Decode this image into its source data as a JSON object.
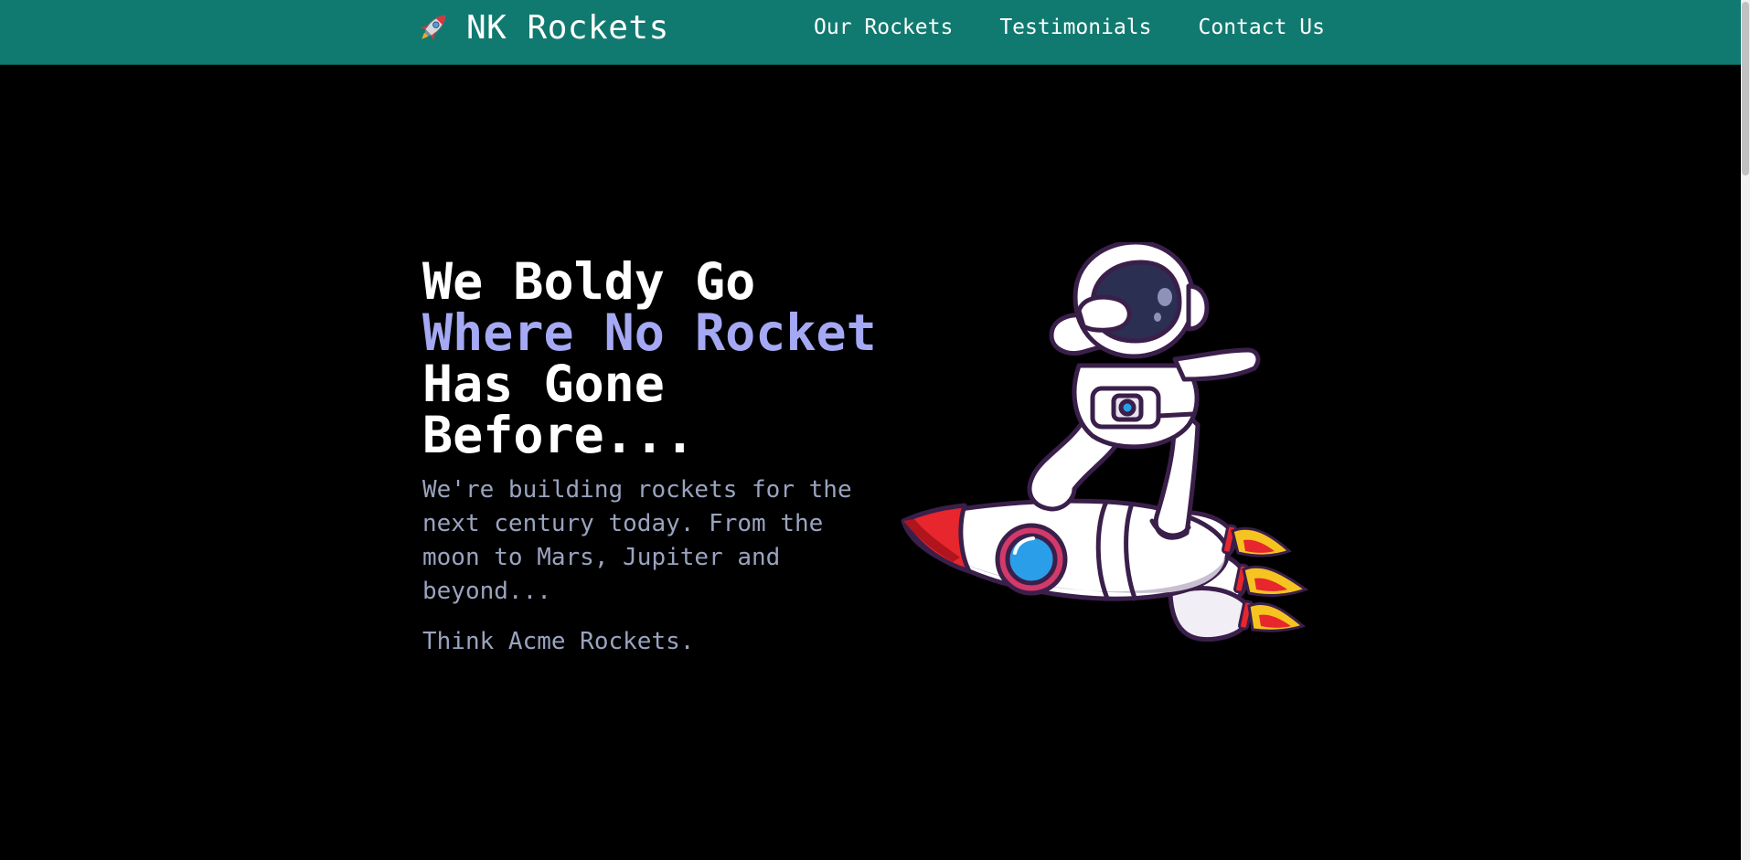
{
  "header": {
    "logo_icon": "rocket-icon",
    "brand_name": "NK Rockets",
    "nav": [
      {
        "label": "Our Rockets"
      },
      {
        "label": "Testimonials"
      },
      {
        "label": "Contact Us"
      }
    ],
    "background_color": "#117a70"
  },
  "hero": {
    "title_part1": "We Boldy Go ",
    "title_highlight": "Where No Rocket",
    "title_part2": " Has Gone Before...",
    "description": "We're building rockets for the next century today. From the moon to Mars, Jupiter and beyond...",
    "tagline": "Think Acme Rockets.",
    "illustration": "astronaut-on-rocket-illustration",
    "highlight_color": "#a5a9f4",
    "text_color": "#9aa3bf"
  }
}
